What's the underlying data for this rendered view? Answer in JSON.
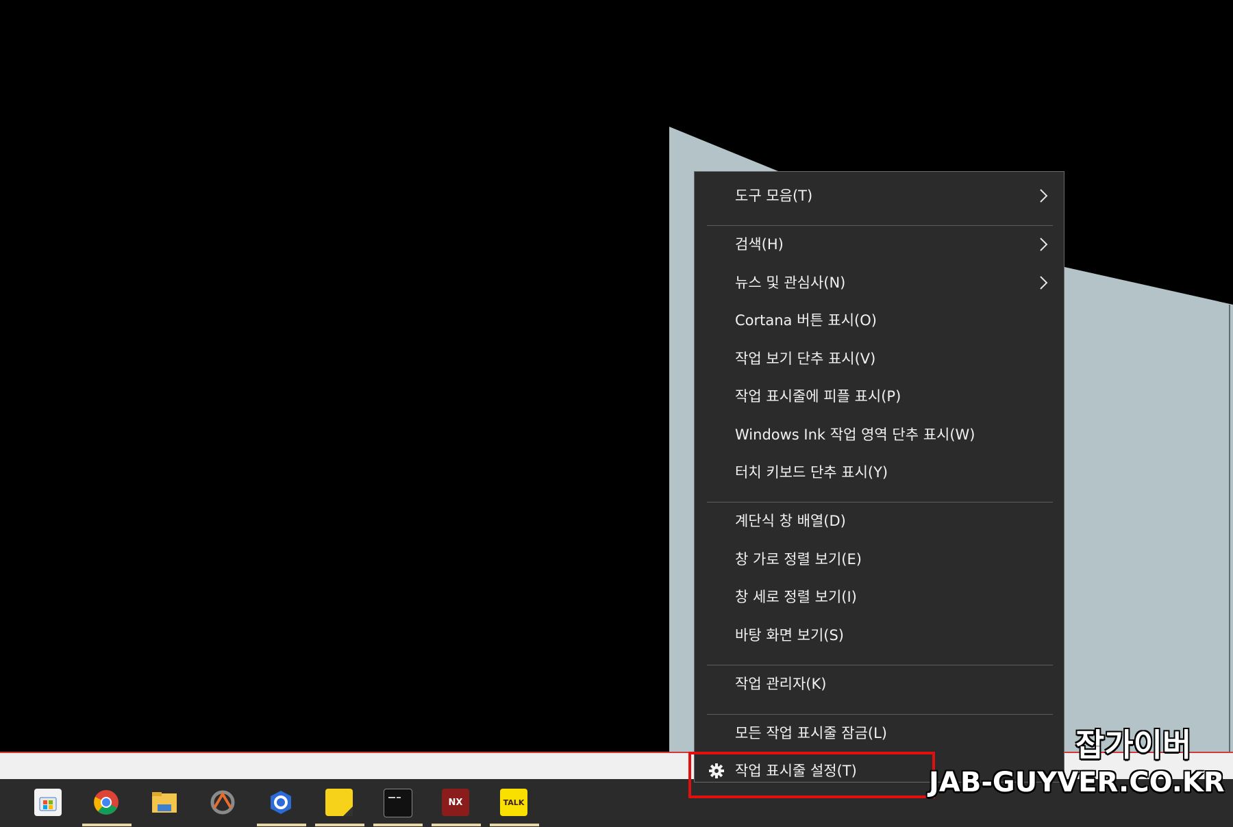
{
  "context_menu": {
    "items": [
      {
        "label": "도구 모음(T)",
        "submenu": true
      },
      {
        "label": "검색(H)",
        "submenu": true
      },
      {
        "label": "뉴스 및 관심사(N)",
        "submenu": true
      },
      {
        "label": "Cortana 버튼 표시(O)",
        "submenu": false
      },
      {
        "label": "작업 보기 단추 표시(V)",
        "submenu": false
      },
      {
        "label": "작업 표시줄에 피플 표시(P)",
        "submenu": false
      },
      {
        "label": "Windows Ink 작업 영역 단추 표시(W)",
        "submenu": false
      },
      {
        "label": "터치 키보드 단추 표시(Y)",
        "submenu": false
      },
      {
        "label": "계단식 창 배열(D)",
        "submenu": false
      },
      {
        "label": "창 가로 정렬 보기(E)",
        "submenu": false
      },
      {
        "label": "창 세로 정렬 보기(I)",
        "submenu": false
      },
      {
        "label": "바탕 화면 보기(S)",
        "submenu": false
      },
      {
        "label": "작업 관리자(K)",
        "submenu": false
      },
      {
        "label": "모든 작업 표시줄 잠금(L)",
        "submenu": false
      },
      {
        "label": "작업 표시줄 설정(T)",
        "submenu": false,
        "icon": "gear-icon"
      }
    ]
  },
  "taskbar": {
    "apps": [
      {
        "name": "microsoft-store-icon",
        "color": "#f3f3f3"
      },
      {
        "name": "chrome-icon",
        "color": "#2b2b2b"
      },
      {
        "name": "file-explorer-icon",
        "color": "#f3c54c"
      },
      {
        "name": "davinci-resolve-icon",
        "color": "#2b2b2b"
      },
      {
        "name": "browser-app-icon",
        "color": "#2b2b2b"
      },
      {
        "name": "sticky-notes-icon",
        "color": "#f7d21b"
      },
      {
        "name": "command-prompt-icon",
        "color": "#111111"
      },
      {
        "name": "nx-app-icon",
        "color": "#8b1c1c",
        "text": "NX"
      },
      {
        "name": "kakaotalk-icon",
        "color": "#f9e000",
        "text": "TALK"
      }
    ]
  },
  "watermark": {
    "line1": "잡가이버",
    "line2": "JAB-GUYVER.CO.KR"
  }
}
